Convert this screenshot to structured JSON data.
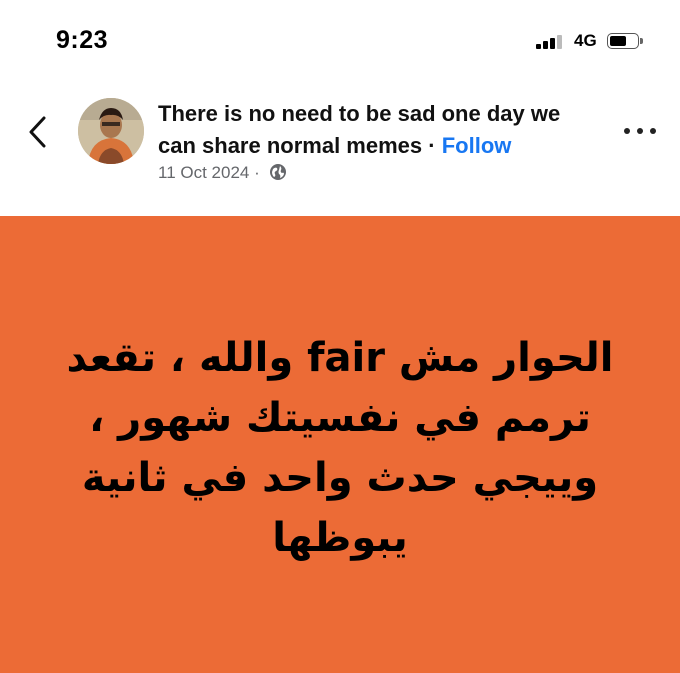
{
  "status_bar": {
    "time": "9:23",
    "network": "4G"
  },
  "post": {
    "title": "There is no need to be sad one day we can share normal memes",
    "separator": "·",
    "follow_label": "Follow",
    "date": "11 Oct 2024",
    "meta_separator": "·",
    "audience_icon": "globe-icon"
  },
  "meme": {
    "background_color": "#ec6b36",
    "lines": [
      "الحوار مش fair والله ، تقعد",
      "ترمم في نفسيتك شهور ،",
      "وييجي حدث واحد في ثانية",
      "يبوظها"
    ]
  },
  "colors": {
    "link": "#1877f2",
    "meta_text": "#65676b"
  }
}
